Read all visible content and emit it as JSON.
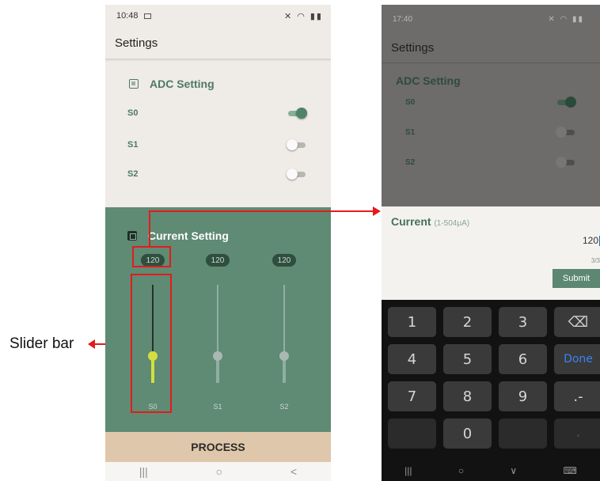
{
  "annotation": {
    "label": "Slider bar"
  },
  "phone1": {
    "status": {
      "time": "10:48",
      "time_icon": "image-icon",
      "right_icons": "signal-icons"
    },
    "appbar": {
      "title": "Settings"
    },
    "adc": {
      "title": "ADC Setting",
      "switches": [
        {
          "label": "S0",
          "on": true
        },
        {
          "label": "S1",
          "on": false
        },
        {
          "label": "S2",
          "on": false
        }
      ]
    },
    "current": {
      "title": "Current Setting",
      "channels": [
        {
          "value": "120",
          "label": "S0",
          "level": 0.24,
          "active": true
        },
        {
          "value": "120",
          "label": "S1",
          "level": 0.24,
          "active": false
        },
        {
          "value": "120",
          "label": "S2",
          "level": 0.24,
          "active": false
        }
      ]
    },
    "process_label": "PROCESS",
    "nav": {
      "recent": "|||",
      "home": "○",
      "back": "<"
    }
  },
  "phone2": {
    "status": {
      "time": "17:40"
    },
    "appbar": {
      "title": "Settings"
    },
    "adc": {
      "title": "ADC Setting",
      "switches": [
        {
          "label": "S0",
          "on": true
        },
        {
          "label": "S1",
          "on": false
        },
        {
          "label": "S2",
          "on": false
        }
      ]
    },
    "dialog": {
      "title": "Current",
      "hint": "(1-504μA)",
      "value": "120",
      "counter": "3/3",
      "submit_label": "Submit"
    },
    "keyboard": {
      "keys": [
        "1",
        "2",
        "3",
        "⌫",
        "4",
        "5",
        "6",
        "Done",
        "7",
        "8",
        "9",
        ".-",
        "",
        "0",
        "",
        ","
      ],
      "nav": {
        "recent": "|||",
        "home": "○",
        "back": "∨",
        "keyboard": "⌨"
      }
    }
  },
  "colors": {
    "accent_green": "#5f8a74",
    "slider_active": "#d4df3d",
    "annotation_red": "#e31b1b",
    "process_bg": "#dec7aa"
  }
}
